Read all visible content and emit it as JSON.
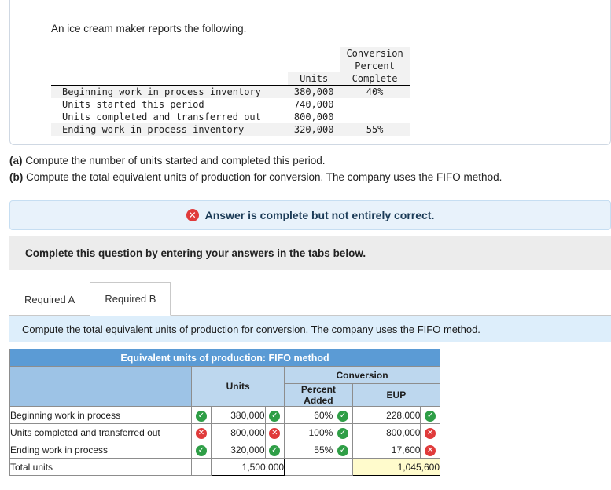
{
  "problem": {
    "intro": "An ice cream maker reports the following.",
    "table": {
      "headers": {
        "col_units": "Units",
        "col_conversion": "Conversion",
        "col_percent": "Percent",
        "col_complete": "Complete"
      },
      "rows": [
        {
          "label": "Beginning work in process inventory",
          "units": "380,000",
          "percent": "40%"
        },
        {
          "label": "Units started this period",
          "units": "740,000",
          "percent": ""
        },
        {
          "label": "Units completed and transferred out",
          "units": "800,000",
          "percent": ""
        },
        {
          "label": "Ending work in process inventory",
          "units": "320,000",
          "percent": "55%"
        }
      ]
    }
  },
  "questions": {
    "a_label": "(a)",
    "a_text": " Compute the number of units started and completed this period.",
    "b_label": "(b)",
    "b_text": " Compute the total equivalent units of production for conversion. The company uses the FIFO method."
  },
  "alert": {
    "icon": "x-circle-icon",
    "text": "Answer is complete but not entirely correct."
  },
  "instruction": "Complete this question by entering your answers in the tabs below.",
  "tabs": [
    {
      "label": "Required A",
      "active": false
    },
    {
      "label": "Required B",
      "active": true
    }
  ],
  "tab_content_heading": "Compute the total equivalent units of production for conversion. The company uses the FIFO method.",
  "answer_table": {
    "title": "Equivalent units of production: FIFO method",
    "headers": {
      "units": "Units",
      "conversion": "Conversion",
      "percent_added": "Percent\nAdded",
      "percent_added_line1": "Percent",
      "percent_added_line2": "Added",
      "eup": "EUP"
    },
    "rows": [
      {
        "label": "Beginning work in process",
        "label_status": "correct",
        "units": "380,000",
        "units_status": "correct",
        "percent": "60%",
        "percent_status": "correct",
        "eup": "228,000",
        "eup_status": "correct"
      },
      {
        "label": "Units completed and transferred out",
        "label_status": "incorrect",
        "units": "800,000",
        "units_status": "incorrect",
        "percent": "100%",
        "percent_status": "correct",
        "eup": "800,000",
        "eup_status": "incorrect"
      },
      {
        "label": "Ending work in process",
        "label_status": "correct",
        "units": "320,000",
        "units_status": "correct",
        "percent": "55%",
        "percent_status": "correct",
        "eup": "17,600",
        "eup_status": "incorrect"
      }
    ],
    "total_row": {
      "label": "Total units",
      "units": "1,500,000",
      "percent": "",
      "eup": "1,045,600"
    }
  },
  "icons": {
    "check": "✔",
    "cross": "✕"
  },
  "colors": {
    "accent_blue": "#5b9bd5",
    "header_blue": "#bdd7ee",
    "row_blue": "#9dc3e6",
    "correct_green": "#2e9e46",
    "incorrect_red": "#e03b3b",
    "highlight_yellow": "#fffbcc"
  }
}
